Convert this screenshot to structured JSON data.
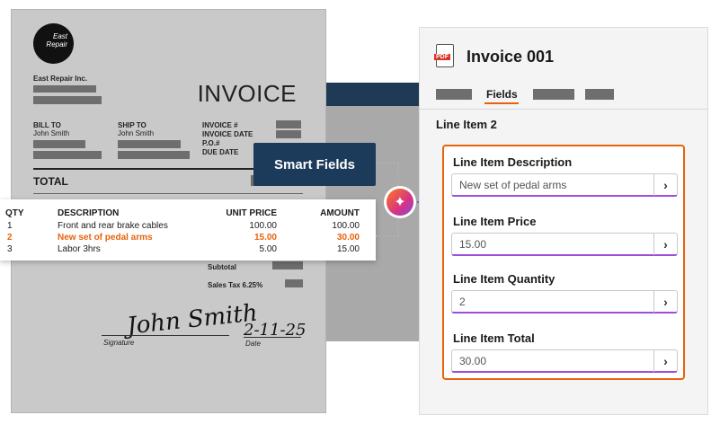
{
  "invoice": {
    "logo_line1": "East",
    "logo_line2": "Repair",
    "company": "East Repair Inc.",
    "title": "INVOICE",
    "bill_to_label": "BILL TO",
    "bill_to_name": "John Smith",
    "ship_to_label": "SHIP TO",
    "ship_to_name": "John Smith",
    "invoice_num_label": "INVOICE #",
    "invoice_date_label": "INVOICE DATE",
    "po_label": "P.O.#",
    "due_date_label": "DUE DATE",
    "total_label": "TOTAL",
    "subtotal_label": "Subtotal",
    "sales_tax_label": "Sales Tax 6.25%",
    "signature_text": "John Smith",
    "signature_caption": "Signature",
    "date_text": "2-11-25",
    "date_caption": "Date"
  },
  "items": {
    "headers": {
      "qty": "QTY",
      "desc": "DESCRIPTION",
      "unit": "UNIT PRICE",
      "amount": "AMOUNT"
    },
    "rows": [
      {
        "qty": "1",
        "desc": "Front and rear brake cables",
        "unit": "100.00",
        "amount": "100.00"
      },
      {
        "qty": "2",
        "desc": "New set of pedal arms",
        "unit": "15.00",
        "amount": "30.00"
      },
      {
        "qty": "3",
        "desc": "Labor 3hrs",
        "unit": "5.00",
        "amount": "15.00"
      }
    ]
  },
  "smart_fields": {
    "label": "Smart Fields",
    "icon": "sparkle-icon"
  },
  "panel": {
    "file_icon": "pdf-icon",
    "file_badge": "PDF",
    "title": "Invoice 001",
    "active_tab": "Fields",
    "section_title": "Line Item 2",
    "fields": [
      {
        "label": "Line Item Description",
        "value": "New set of pedal arms"
      },
      {
        "label": "Line Item Price",
        "value": "15.00"
      },
      {
        "label": "Line Item Quantity",
        "value": "2"
      },
      {
        "label": "Line Item Total",
        "value": "30.00"
      }
    ],
    "accent_color": "#e8620c",
    "underline_color": "#9c4fd6"
  }
}
